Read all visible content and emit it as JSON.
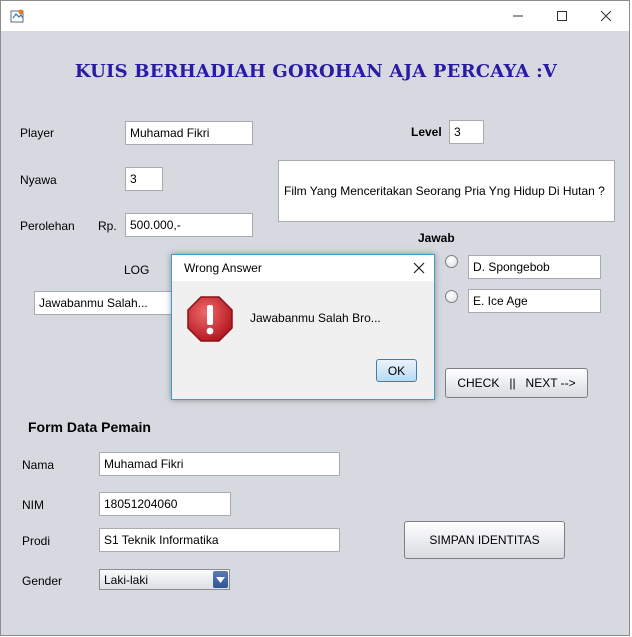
{
  "window": {
    "title": ""
  },
  "heading": "KUIS BERHADIAH GOROHAN AJA PERCAYA :V",
  "game": {
    "player_label": "Player",
    "player_value": "Muhamad Fikri",
    "level_label": "Level",
    "level_value": "3",
    "lives_label": "Nyawa",
    "lives_value": "3",
    "earnings_label": "Perolehan",
    "currency_label": "Rp.",
    "earnings_value": "500.000,-",
    "question": "Film Yang Menceritakan Seorang Pria Yng Hidup Di Hutan ?",
    "answer_label": "Jawab",
    "options": [
      "D. Spongebob",
      "E. Ice Age"
    ],
    "log_label": "LOG",
    "log_value": "Jawabanmu Salah...",
    "check_next_label": "CHECK   ||   NEXT -->"
  },
  "form": {
    "title": "Form Data Pemain",
    "name_label": "Nama",
    "name_value": "Muhamad Fikri",
    "nim_label": "NIM",
    "nim_value": "18051204060",
    "prodi_label": "Prodi",
    "prodi_value": "S1 Teknik Informatika",
    "gender_label": "Gender",
    "gender_value": "Laki-laki",
    "save_label": "SIMPAN IDENTITAS"
  },
  "dialog": {
    "title": "Wrong Answer",
    "message": "Jawabanmu Salah Bro...",
    "ok_label": "OK",
    "icon": "error-stop-icon"
  },
  "colors": {
    "heading": "#2b1aa3",
    "window_bg": "#d6d9df",
    "dialog_border": "#3c9bd1",
    "error_icon": "#c8232c"
  }
}
